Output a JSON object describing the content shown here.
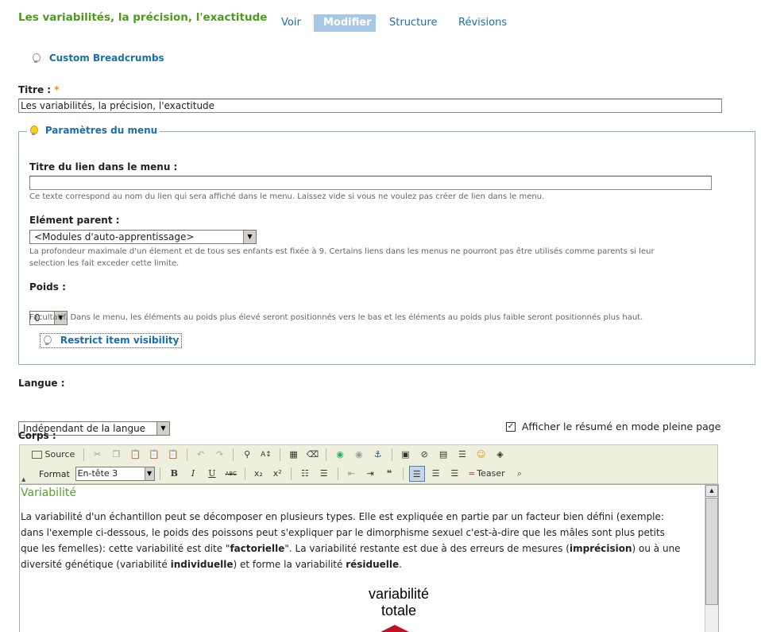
{
  "page": {
    "title": "Les variabilités, la précision, l'exactitude"
  },
  "tabs": [
    {
      "label": "Voir",
      "active": false
    },
    {
      "label": "Modifier",
      "active": true
    },
    {
      "label": "Structure",
      "active": false
    },
    {
      "label": "Révisions",
      "active": false
    }
  ],
  "custom_breadcrumbs": "Custom Breadcrumbs",
  "titre": {
    "label": "Titre :",
    "required_mark": "*",
    "value": "Les variabilités, la précision, l'exactitude"
  },
  "menu": {
    "legend": "Paramètres du menu",
    "link_title_label": "Titre du lien dans le menu :",
    "link_title_value": "",
    "link_title_desc": "Ce texte correspond au nom du lien qui sera affiché dans le menu. Laissez vide si vous ne voulez pas créer de lien dans le menu.",
    "parent_label": "Elément parent :",
    "parent_value": "<Modules d'auto-apprentissage>",
    "parent_desc_1": "La profondeur maximale d'un élement et de tous ses enfants est fixée à 9. Certains liens dans les menus ne pourront pas être utilisés comme parents si leur",
    "parent_desc_2": "selection les fait exceder cette limite.",
    "weight_label": "Poids :",
    "weight_value": "0",
    "weight_desc": "Facultatif. Dans le menu, les éléments au poids plus élevé seront positionnés vers le bas et les éléments au poids plus faible seront positionnés plus haut.",
    "restrict_link": "Restrict item visibility"
  },
  "langue": {
    "label": "Langue :",
    "value": "Indépendant de la langue"
  },
  "summary_checkbox": {
    "label": "Afficher le résumé en mode pleine page",
    "checked": true
  },
  "corps": {
    "label": "Corps :"
  },
  "toolbar": {
    "source_label": "Source",
    "format_label": "Format",
    "format_value": "En-tête 3",
    "teaser_label": "Teaser",
    "bold": "B",
    "italic": "I",
    "underline": "U",
    "strike": "ABC",
    "subscript": "x₂",
    "superscript": "x²"
  },
  "content": {
    "heading": "Variabilité",
    "p_line1": "La variabilité d'un échantillon peut se décomposer en plusieurs types. Elle est expliquée en partie par un facteur bien défini (exemple:",
    "p_line2": "dans l'exemple ci-dessous, le poids des poissons peut s'expliquer par le dimorphisme sexuel c'est-à-dire que les mâles sont plus petits",
    "p_line3_a": "que les femelles): cette variabilité est dite \"",
    "p_line3_b": "factorielle",
    "p_line3_c": "\". La variabilité restante est due à des erreurs de mesures (",
    "p_line3_d": "imprécision",
    "p_line3_e": ") ou à une",
    "p_line4_a": "diversité génétique (variabilité ",
    "p_line4_b": "individuelle",
    "p_line4_c": ") et forme la variabilité ",
    "p_line4_d": "résiduelle",
    "p_line4_e": ".",
    "figure_line1": "variabilité",
    "figure_line2": "totale"
  },
  "colors": {
    "title_green": "#4c9a1c",
    "link_blue": "#1b6fa8",
    "active_tab": "#a7c8e4",
    "heading_green": "#5aa02c"
  }
}
